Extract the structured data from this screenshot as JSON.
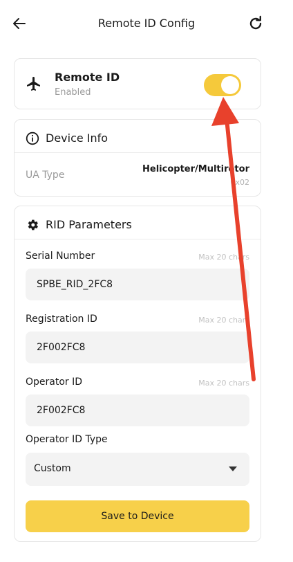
{
  "header": {
    "title": "Remote ID Config"
  },
  "remote_id": {
    "name": "Remote ID",
    "status": "Enabled",
    "toggle_on": true,
    "toggle_color": "#f5c93b"
  },
  "device_info": {
    "title": "Device Info",
    "ua_type_label": "UA Type",
    "ua_type_value": "Helicopter/Multirotor",
    "ua_type_code": "0x02"
  },
  "rid_params": {
    "title": "RID Parameters",
    "serial_label": "Serial Number",
    "serial_hint": "Max 20 chars",
    "serial_value": "SPBE_RID_2FC8",
    "registration_label": "Registration ID",
    "registration_hint": "Max 20 chars",
    "registration_value": "2F002FC8",
    "operator_label": "Operator ID",
    "operator_hint": "Max 20 chars",
    "operator_value": "2F002FC8",
    "operator_type_label": "Operator ID Type",
    "operator_type_value": "Custom",
    "save_label": "Save to Device"
  },
  "colors": {
    "accent": "#f7d04a",
    "annotation_arrow": "#e8412c"
  }
}
